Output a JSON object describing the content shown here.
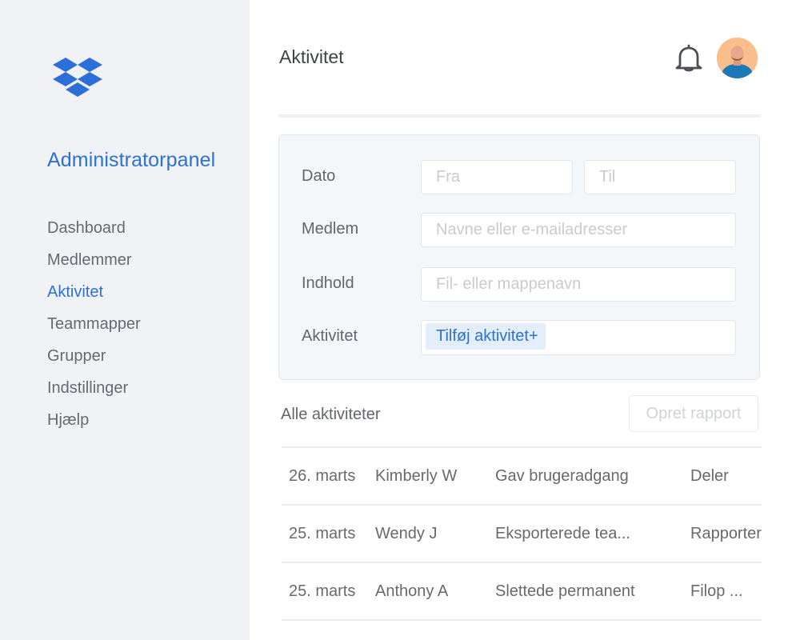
{
  "sidebar": {
    "logo": "dropbox-logo",
    "title": "Administratorpanel",
    "items": [
      {
        "label": "Dashboard",
        "active": false
      },
      {
        "label": "Medlemmer",
        "active": false
      },
      {
        "label": "Aktivitet",
        "active": true
      },
      {
        "label": "Teammapper",
        "active": false
      },
      {
        "label": "Grupper",
        "active": false
      },
      {
        "label": "Indstillinger",
        "active": false
      },
      {
        "label": "Hjælp",
        "active": false
      }
    ]
  },
  "header": {
    "title": "Aktivitet",
    "notification_icon": "bell-icon",
    "avatar": "user-avatar"
  },
  "filters": {
    "date": {
      "label": "Dato",
      "from_placeholder": "Fra",
      "to_placeholder": "Til"
    },
    "member": {
      "label": "Medlem",
      "placeholder": "Navne eller e-mailadresser"
    },
    "content": {
      "label": "Indhold",
      "placeholder": "Fil- eller mappenavn"
    },
    "activity": {
      "label": "Aktivitet",
      "tag": "Tilføj aktivitet+"
    }
  },
  "activities": {
    "title": "Alle aktiviteter",
    "report_button": "Opret rapport",
    "rows": [
      {
        "date": "26. marts",
        "member": "Kimberly W",
        "action": "Gav brugeradgang",
        "type": "Deler"
      },
      {
        "date": "25. marts",
        "member": "Wendy J",
        "action": "Eksporterede tea...",
        "type": "Rapporter"
      },
      {
        "date": "25. marts",
        "member": "Anthony A",
        "action": "Slettede permanent",
        "type": "Filop ..."
      }
    ]
  },
  "colors": {
    "accent": "#2d72d2",
    "sidebar_bg": "#f0f2f5",
    "panel_bg": "#f4f7fa",
    "tag_bg": "#e3eef9"
  }
}
